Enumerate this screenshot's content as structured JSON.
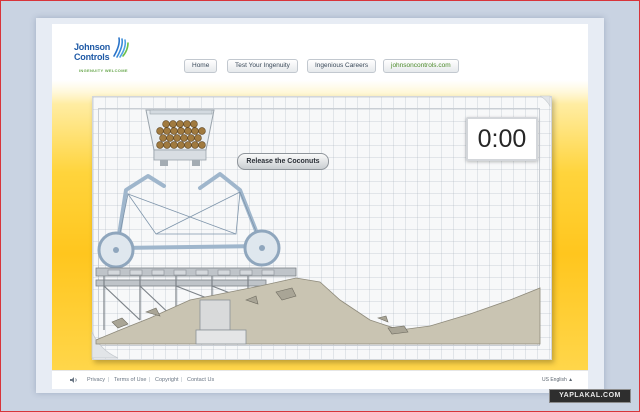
{
  "brand": {
    "name_line1": "Johnson",
    "name_line2": "Controls",
    "tagline": "INGENUITY WELCOME",
    "colors": {
      "primary_blue": "#1f5aa6",
      "green": "#6aa84f"
    }
  },
  "nav": {
    "items": [
      {
        "label": "Home"
      },
      {
        "label": "Test Your Ingenuity"
      },
      {
        "label": "Ingenious Careers"
      },
      {
        "label": "johnsoncontrols.com"
      }
    ]
  },
  "game": {
    "timer": "0:00",
    "release_button": "Release the Coconuts"
  },
  "footer": {
    "sound_icon": "speaker-icon",
    "links": [
      "Privacy",
      "Terms of Use",
      "Copyright",
      "Contact Us"
    ],
    "locale": "US English"
  },
  "watermark": "YAPLAKAL.COM",
  "colors": {
    "accent_yellow": "#ffc61e",
    "timer_text": "#262626"
  }
}
